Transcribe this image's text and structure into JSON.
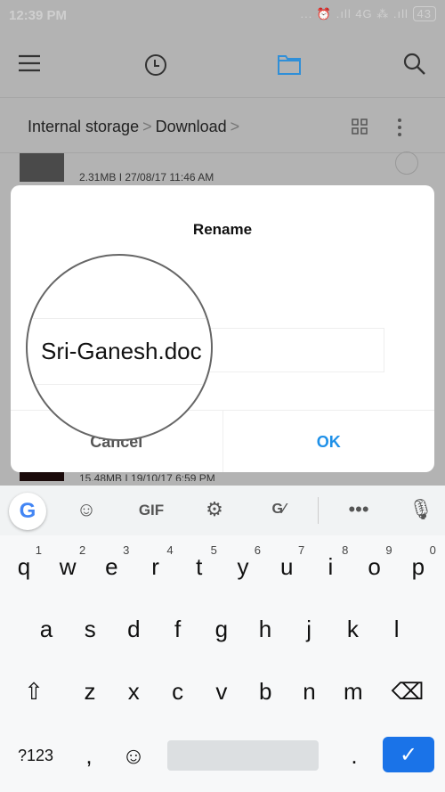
{
  "status": {
    "time": "12:39 PM",
    "indicators": "... ⏰ .ıll 4G ⁂ .ıll",
    "battery": "43"
  },
  "toolbar": {
    "icons": [
      "menu-icon",
      "clock-icon",
      "folder-icon",
      "search-icon"
    ],
    "accent": "#2f8fd8"
  },
  "breadcrumb": {
    "items": [
      "Internal storage",
      "Download"
    ],
    "sep": ">"
  },
  "files": [
    {
      "meta": "2.31MB  I  27/08/17 11:46 AM"
    },
    {
      "meta": "15.48MB  I  19/10/17 6:59 PM"
    }
  ],
  "dialog": {
    "title": "Rename",
    "value": "Sri-Ganesh.doc",
    "cancel": "Cancel",
    "ok": "OK",
    "ok_color": "#1e90e8"
  },
  "keyboard": {
    "suggestions": {
      "gif": "GIF"
    },
    "row1": [
      [
        "q",
        "1"
      ],
      [
        "w",
        "2"
      ],
      [
        "e",
        "3"
      ],
      [
        "r",
        "4"
      ],
      [
        "t",
        "5"
      ],
      [
        "y",
        "6"
      ],
      [
        "u",
        "7"
      ],
      [
        "i",
        "8"
      ],
      [
        "o",
        "9"
      ],
      [
        "p",
        "0"
      ]
    ],
    "row2": [
      "a",
      "s",
      "d",
      "f",
      "g",
      "h",
      "j",
      "k",
      "l"
    ],
    "row3": [
      "z",
      "x",
      "c",
      "v",
      "b",
      "n",
      "m"
    ],
    "symbols": "?123",
    "comma": ",",
    "period": ".",
    "emoji": "☺",
    "enter": "✓",
    "shift": "⇧",
    "backspace": "⌫",
    "enter_color": "#1a73e8"
  }
}
